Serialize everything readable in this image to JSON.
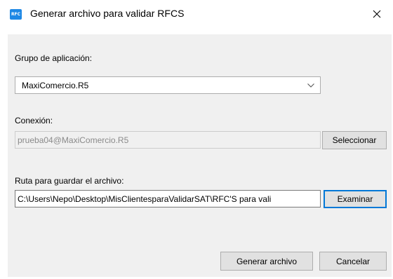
{
  "window": {
    "title": "Generar archivo para validar RFCS",
    "icon_text": "RFC",
    "close_icon": "close-icon"
  },
  "form": {
    "grupo_label": "Grupo de aplicación:",
    "grupo_value": "MaxiComercio.R5",
    "conexion_label": "Conexión:",
    "conexion_value": "prueba04@MaxiComercio.R5",
    "seleccionar_label": "Seleccionar",
    "ruta_label": "Ruta para guardar el archivo:",
    "ruta_value": "C:\\Users\\Nepo\\Desktop\\MisClientesparaValidarSAT\\RFC'S para vali",
    "examinar_label": "Examinar"
  },
  "footer": {
    "generar_label": "Generar archivo",
    "cancelar_label": "Cancelar"
  },
  "colors": {
    "accent": "#0078d7",
    "dialog_bg": "#f0f0f0",
    "icon_bg": "#1e88e5"
  }
}
